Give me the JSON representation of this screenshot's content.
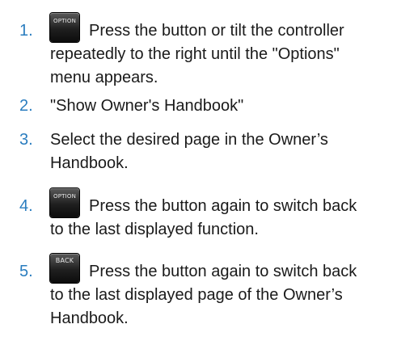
{
  "steps": [
    {
      "number": "1.",
      "icon": {
        "name": "option-button-icon",
        "label": "OPTION"
      },
      "line1": "Press the button or tilt the controller",
      "line2": "repeatedly to the right until the \"Options\"",
      "line3": "menu appears."
    },
    {
      "number": "2.",
      "line1": "\"Show Owner's Handbook\""
    },
    {
      "number": "3.",
      "line1": "Select the desired page in the Owner’s",
      "line2": "Handbook."
    },
    {
      "number": "4.",
      "icon": {
        "name": "option-button-icon",
        "label": "OPTION"
      },
      "line1": "Press the button again to switch back",
      "line2": "to the last displayed function."
    },
    {
      "number": "5.",
      "icon": {
        "name": "back-button-icon",
        "label": "BACK"
      },
      "line1": "Press the button again to switch back",
      "line2": "to the last displayed page of the Owner’s",
      "line3": "Handbook."
    }
  ]
}
